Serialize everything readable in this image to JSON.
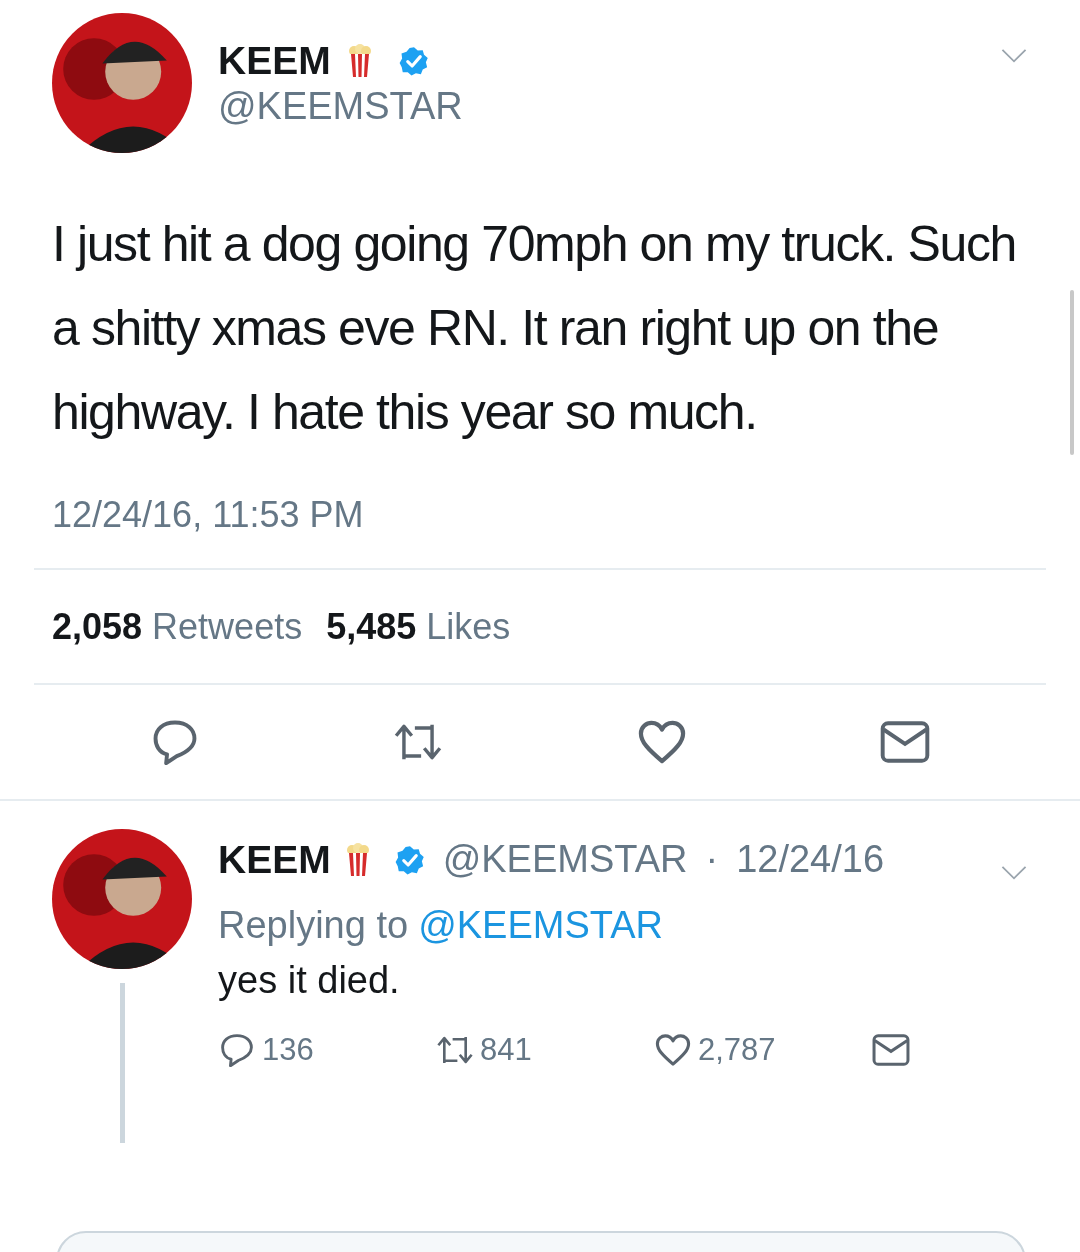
{
  "tweet": {
    "name": "KEEM",
    "handle": "@KEEMSTAR",
    "text": "I just hit a dog going 70mph on my truck. Such a shitty xmas eve RN. It ran right up on the highway. I hate this year so much.",
    "timestamp": "12/24/16, 11:53 PM",
    "retweets": "2,058",
    "retweets_label": "Retweets",
    "likes": "5,485",
    "likes_label": "Likes"
  },
  "reply": {
    "name": "KEEM",
    "handle": "@KEEMSTAR",
    "separator": "·",
    "date": "12/24/16",
    "replying_label": "Replying to",
    "replying_handle": "@KEEMSTAR",
    "text": "yes it died.",
    "replies": "136",
    "retweets": "841",
    "likes": "2,787"
  }
}
